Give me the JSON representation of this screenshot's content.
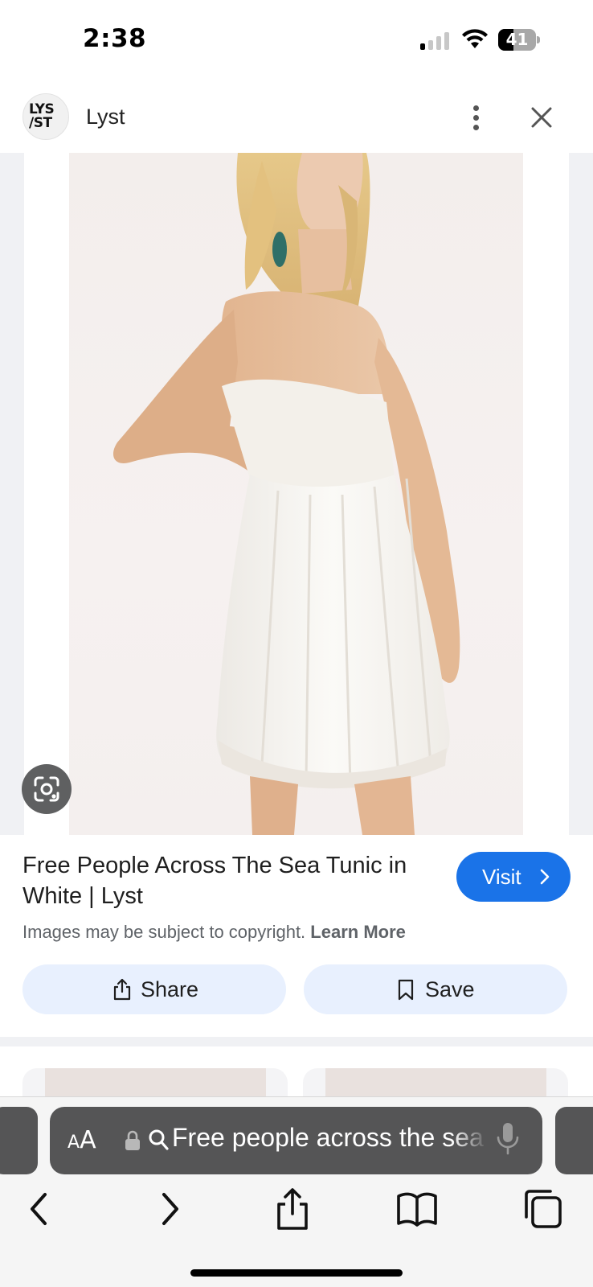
{
  "status_bar": {
    "time": "2:38",
    "battery_level": "41",
    "battery_fraction": 0.41,
    "signal_bars_active": 1,
    "signal_bars_total": 4
  },
  "header": {
    "site_logo_text": "LYST",
    "site_name": "Lyst",
    "more_icon": "more-vertical-icon",
    "close_icon": "close-icon"
  },
  "image": {
    "lens_icon": "google-lens-icon"
  },
  "result": {
    "title": "Free People Across The Sea Tunic in White | Lyst",
    "visit_label": "Visit",
    "copyright_text": "Images may be subject to copyright.",
    "learn_more": "Learn More",
    "share_label": "Share",
    "save_label": "Save",
    "accent_color": "#1a73e8",
    "chip_color": "#e8f0fe"
  },
  "browser": {
    "aa_small": "A",
    "aa_big": "A",
    "url_text": "Free people across the sea",
    "toolbar": [
      "back-icon",
      "forward-icon",
      "share-icon",
      "bookmarks-icon",
      "tabs-icon"
    ]
  }
}
